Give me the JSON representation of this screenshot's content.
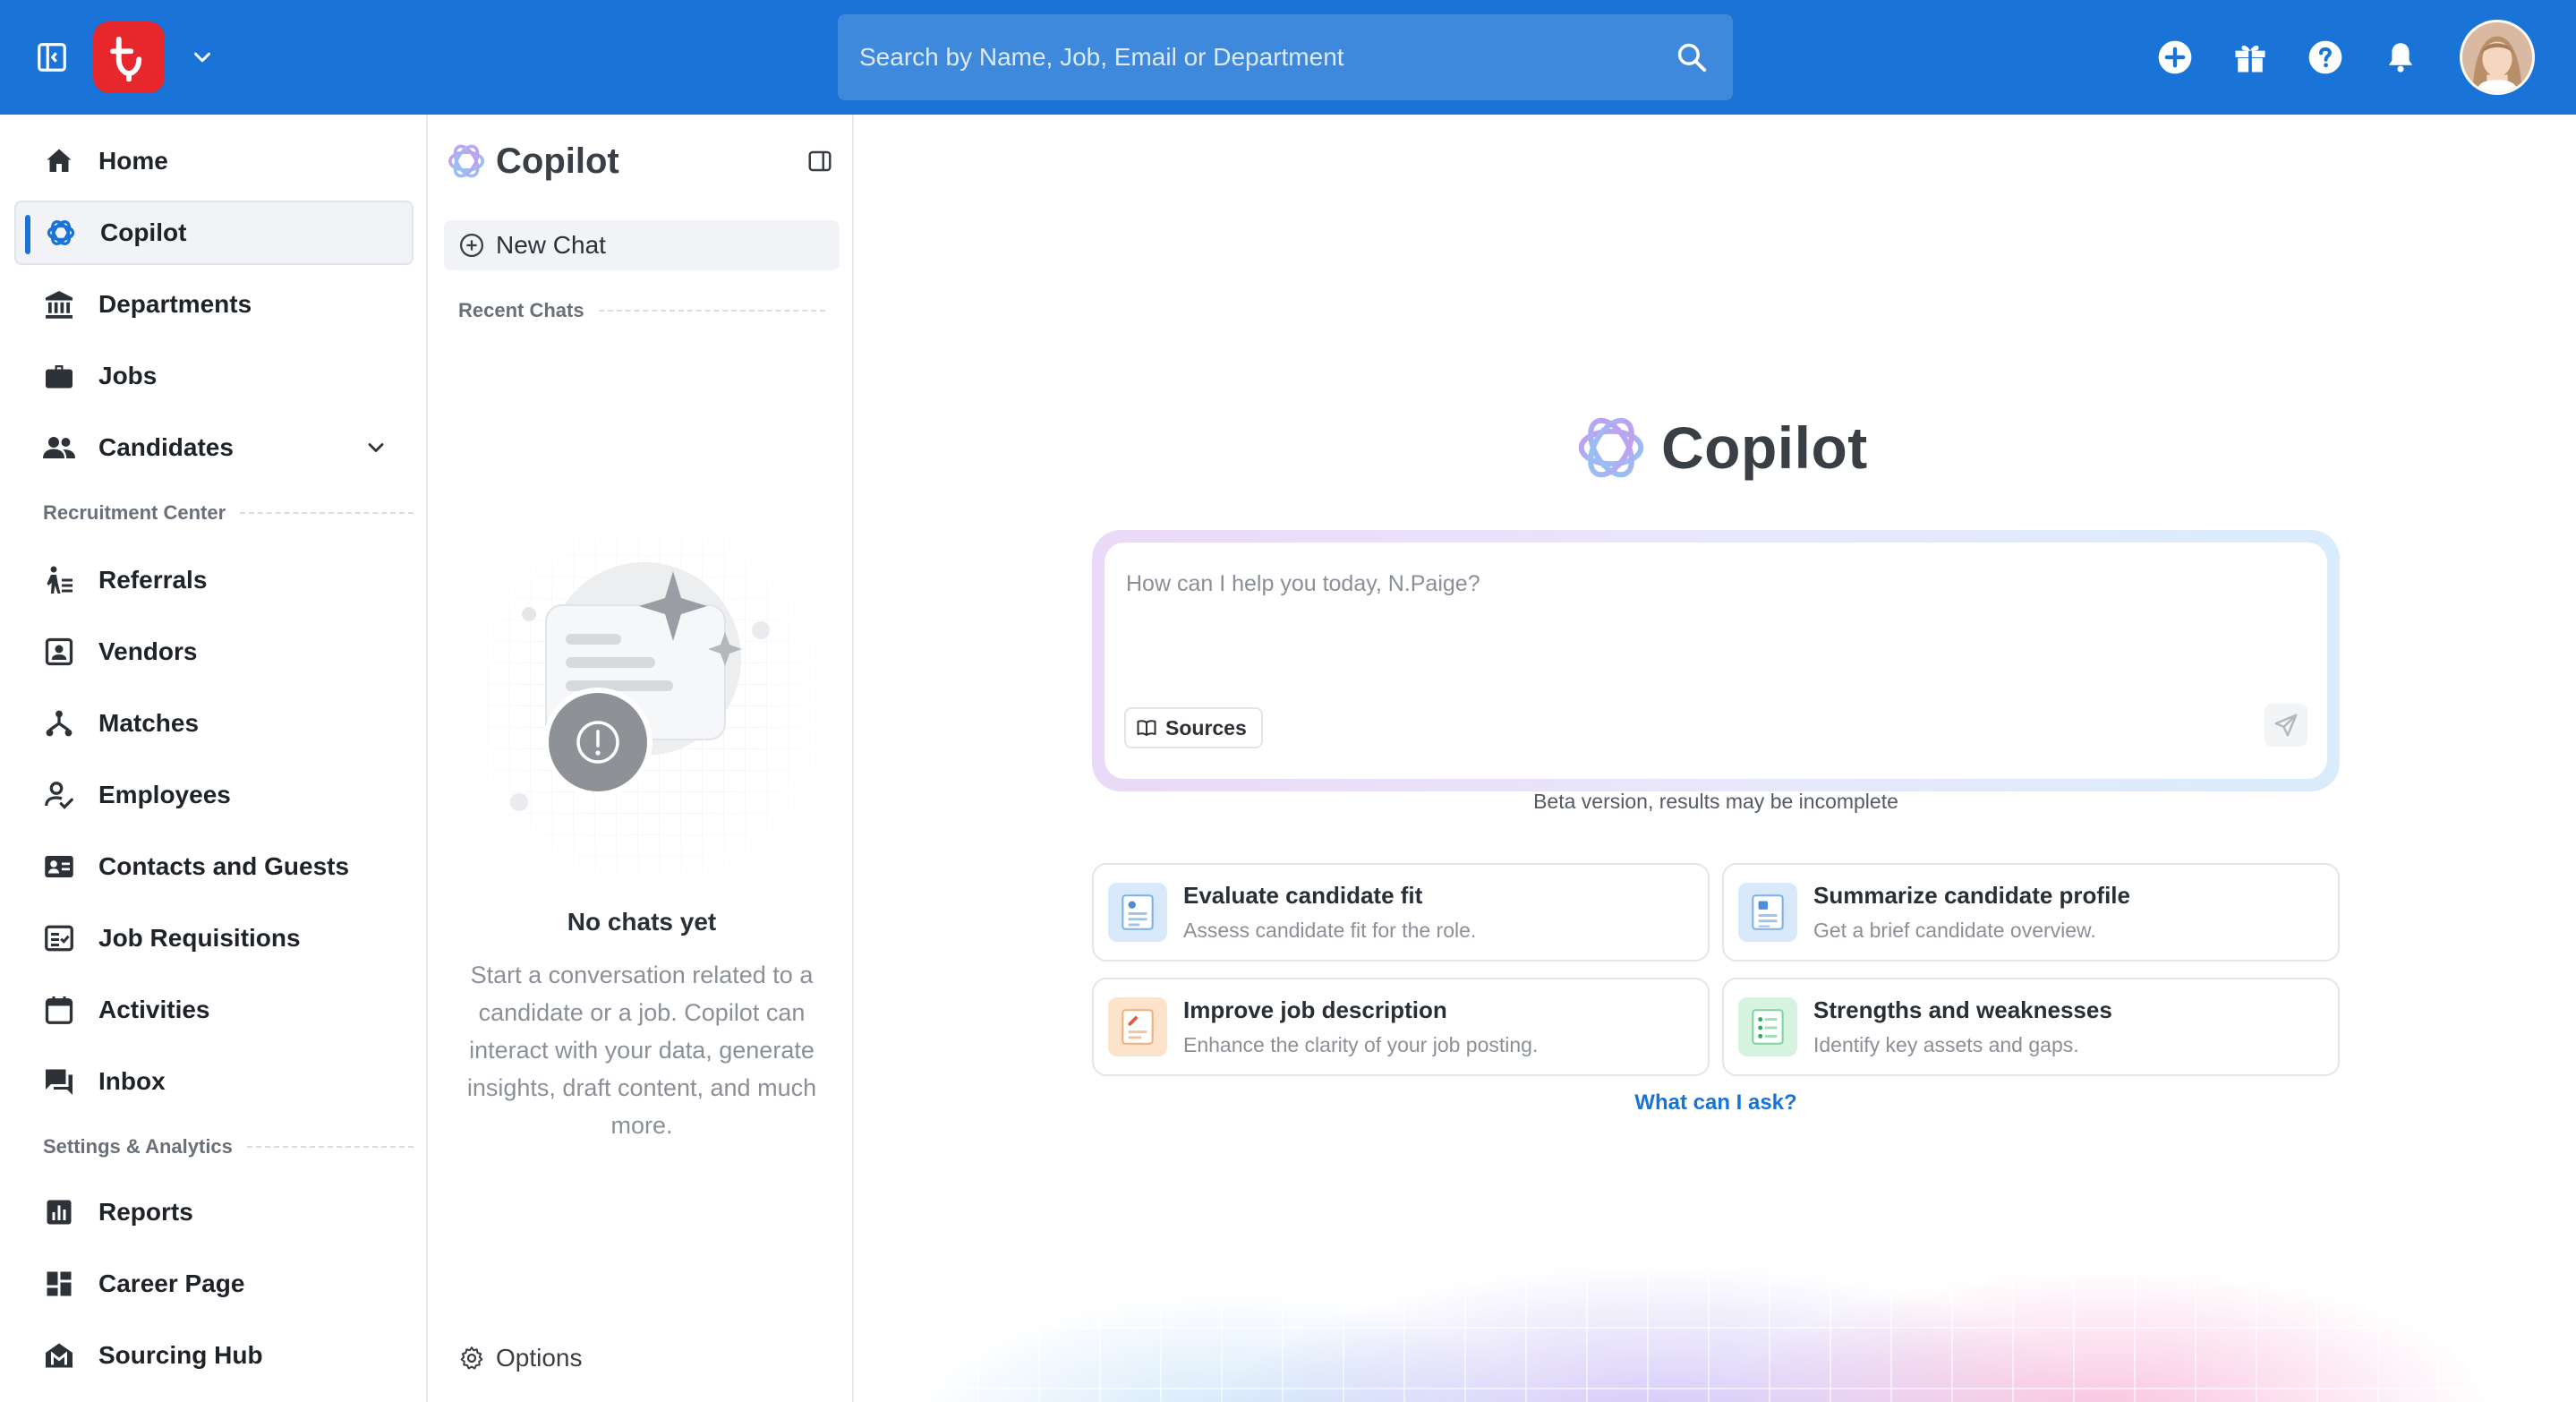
{
  "app": {
    "brand_color": "#1a73d6",
    "logo_color": "#e8272d"
  },
  "topbar": {
    "search": {
      "placeholder": "Search by Name, Job, Email or Department",
      "value": ""
    },
    "icons": [
      "sidebar-toggle-icon",
      "app-logo",
      "chevron-down-icon",
      "search-icon",
      "add-circle-icon",
      "gift-icon",
      "help-icon",
      "bell-icon",
      "user-avatar"
    ]
  },
  "leftnav": {
    "items": [
      {
        "label": "Home",
        "icon": "home-icon"
      },
      {
        "label": "Copilot",
        "icon": "copilot-icon",
        "active": true
      },
      {
        "label": "Departments",
        "icon": "bank-icon"
      },
      {
        "label": "Jobs",
        "icon": "briefcase-icon"
      },
      {
        "label": "Candidates",
        "icon": "people-icon",
        "expandable": true
      }
    ],
    "section_recruitment": "Recruitment Center",
    "recruitment_items": [
      {
        "label": "Referrals",
        "icon": "referral-icon"
      },
      {
        "label": "Vendors",
        "icon": "vendor-icon"
      },
      {
        "label": "Matches",
        "icon": "network-icon"
      },
      {
        "label": "Employees",
        "icon": "employee-icon"
      },
      {
        "label": "Contacts and Guests",
        "icon": "contact-card-icon"
      },
      {
        "label": "Job Requisitions",
        "icon": "checklist-icon"
      },
      {
        "label": "Activities",
        "icon": "calendar-icon"
      },
      {
        "label": "Inbox",
        "icon": "chat-icon"
      }
    ],
    "section_settings": "Settings & Analytics",
    "settings_items": [
      {
        "label": "Reports",
        "icon": "bar-chart-icon"
      },
      {
        "label": "Career Page",
        "icon": "dashboard-icon"
      },
      {
        "label": "Sourcing Hub",
        "icon": "sourcing-icon"
      }
    ]
  },
  "chatpanel": {
    "title": "Copilot",
    "new_chat": "New Chat",
    "recent_chats": "Recent Chats",
    "empty_title": "No chats yet",
    "empty_desc": "Start a conversation related to a candidate or a job. Copilot can interact with your data, generate insights, draft content, and much more.",
    "options": "Options"
  },
  "main": {
    "hero_title": "Copilot",
    "prompt": {
      "placeholder": "How can I help you today, N.Paige?",
      "value": ""
    },
    "sources_label": "Sources",
    "beta_note": "Beta version, results may be incomplete",
    "cards": [
      {
        "title": "Evaluate candidate fit",
        "desc": "Assess candidate fit for the role.",
        "icon": "candidate-fit-icon",
        "color": "#d8e9fb"
      },
      {
        "title": "Summarize candidate profile",
        "desc": "Get a brief candidate overview.",
        "icon": "profile-summary-icon",
        "color": "#d8e9fb"
      },
      {
        "title": "Improve job description",
        "desc": "Enhance the clarity of your job posting.",
        "icon": "edit-document-icon",
        "color": "#fde3cc"
      },
      {
        "title": "Strengths and weaknesses",
        "desc": "Identify key assets and gaps.",
        "icon": "strengths-icon",
        "color": "#d6f3e0"
      }
    ],
    "what_can_i_ask": "What can I ask?"
  }
}
